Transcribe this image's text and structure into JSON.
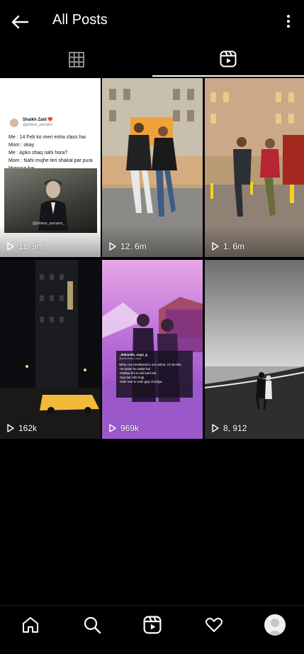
{
  "header": {
    "title": "All Posts"
  },
  "tabs": [
    {
      "name": "grid",
      "icon": "grid-icon",
      "active": false
    },
    {
      "name": "reels",
      "icon": "reels-icon",
      "active": true
    }
  ],
  "posts": [
    {
      "views": "11. 9m",
      "tweet": {
        "name": "Shaikh Zaid ❤️",
        "handle": "@jobless_sarcasm",
        "body": "Me : 14 Feb ko meri extra class hai\nMom : okay\nMe : Apko shaq nahi hora?\nMom : Nahi mujhe teri shakal par pura bharosa hai.....",
        "image_tag": "@jobless_sarcasm_"
      }
    },
    {
      "views": "12. 6m"
    },
    {
      "views": "1. 6m"
    },
    {
      "views": "162k"
    },
    {
      "views": "969k",
      "overlay": {
        "handle": "_dekomila_naya_g",
        "sub": "@dekomila_naya",
        "text": "When my bestfriend is not online, I'm be like\n-Ye kaise ho sakta hai\n-Padhai bhi to nhi karti hai\n-Kya kar rahi hogi\n-Kahi mar to nahi gayi chudiya"
      }
    },
    {
      "views": "8, 912"
    }
  ],
  "nav": {
    "items": [
      "home-icon",
      "search-icon",
      "reels-icon",
      "heart-icon",
      "profile-avatar"
    ]
  }
}
